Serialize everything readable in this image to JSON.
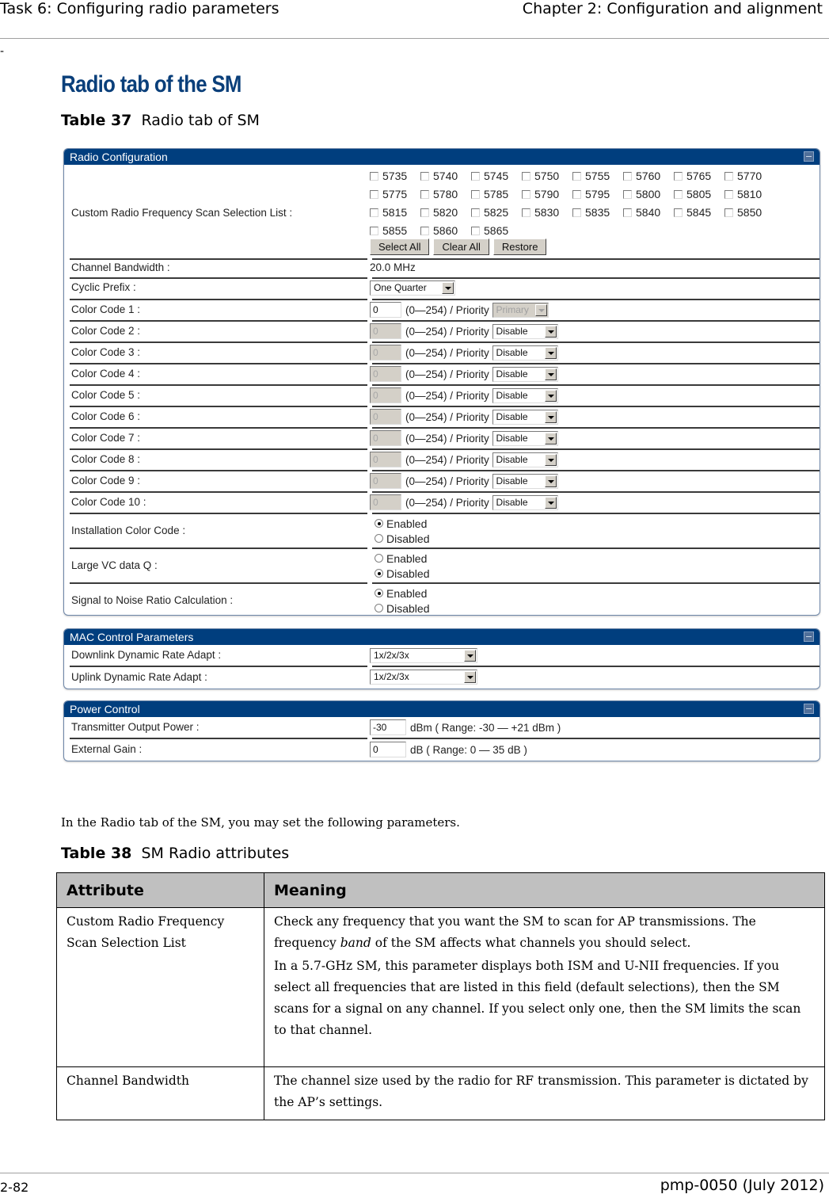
{
  "header": {
    "left": "Task 6: Configuring radio parameters",
    "right": "Chapter 2:  Configuration and alignment",
    "dash": "-"
  },
  "section_title": "Radio tab of the SM",
  "table37": {
    "label": "Table 37",
    "title": "Radio tab of SM"
  },
  "radio_config": {
    "title": "Radio Configuration",
    "scan_list": {
      "label": "Custom Radio Frequency Scan Selection List :",
      "frequencies": [
        "5735",
        "5740",
        "5745",
        "5750",
        "5755",
        "5760",
        "5765",
        "5770",
        "5775",
        "5780",
        "5785",
        "5790",
        "5795",
        "5800",
        "5805",
        "5810",
        "5815",
        "5820",
        "5825",
        "5830",
        "5835",
        "5840",
        "5845",
        "5850",
        "5855",
        "5860",
        "5865"
      ],
      "checked": [],
      "buttons": {
        "select_all": "Select All",
        "clear_all": "Clear All",
        "restore": "Restore"
      }
    },
    "channel_bandwidth": {
      "label": "Channel Bandwidth :",
      "value": "20.0 MHz"
    },
    "cyclic_prefix": {
      "label": "Cyclic Prefix :",
      "value": "One Quarter"
    },
    "color_codes": [
      {
        "label": "Color Code 1 :",
        "value": "0",
        "range": "(0—254) / Priority",
        "priority": "Primary",
        "disabled": false
      },
      {
        "label": "Color Code 2 :",
        "value": "0",
        "range": "(0—254) / Priority",
        "priority": "Disable",
        "disabled": true
      },
      {
        "label": "Color Code 3 :",
        "value": "0",
        "range": "(0—254) / Priority",
        "priority": "Disable",
        "disabled": true
      },
      {
        "label": "Color Code 4 :",
        "value": "0",
        "range": "(0—254) / Priority",
        "priority": "Disable",
        "disabled": true
      },
      {
        "label": "Color Code 5 :",
        "value": "0",
        "range": "(0—254) / Priority",
        "priority": "Disable",
        "disabled": true
      },
      {
        "label": "Color Code 6 :",
        "value": "0",
        "range": "(0—254) / Priority",
        "priority": "Disable",
        "disabled": true
      },
      {
        "label": "Color Code 7 :",
        "value": "0",
        "range": "(0—254) / Priority",
        "priority": "Disable",
        "disabled": true
      },
      {
        "label": "Color Code 8 :",
        "value": "0",
        "range": "(0—254) / Priority",
        "priority": "Disable",
        "disabled": true
      },
      {
        "label": "Color Code 9 :",
        "value": "0",
        "range": "(0—254) / Priority",
        "priority": "Disable",
        "disabled": true
      },
      {
        "label": "Color Code 10 :",
        "value": "0",
        "range": "(0—254) / Priority",
        "priority": "Disable",
        "disabled": true
      }
    ],
    "radios": [
      {
        "label": "Installation Color Code :",
        "options": [
          "Enabled",
          "Disabled"
        ],
        "selected": "Enabled"
      },
      {
        "label": "Large VC data Q :",
        "options": [
          "Enabled",
          "Disabled"
        ],
        "selected": "Disabled"
      },
      {
        "label": "Signal to Noise Ratio Calculation :",
        "options": [
          "Enabled",
          "Disabled"
        ],
        "selected": "Enabled"
      }
    ]
  },
  "mac_control": {
    "title": "MAC Control Parameters",
    "rows": [
      {
        "label": "Downlink Dynamic Rate Adapt :",
        "value": "1x/2x/3x"
      },
      {
        "label": "Uplink Dynamic Rate Adapt :",
        "value": "1x/2x/3x"
      }
    ]
  },
  "power_control": {
    "title": "Power Control",
    "rows": [
      {
        "label": "Transmitter Output Power :",
        "value": "-30",
        "range": "dBm ( Range: -30 — +21 dBm )"
      },
      {
        "label": "External Gain :",
        "value": "0",
        "range": "dB ( Range: 0 — 35 dB )"
      }
    ]
  },
  "intro_text": "In the Radio tab of the SM, you may set the following parameters.",
  "table38": {
    "label": "Table 38",
    "title": "SM Radio attributes",
    "headers": [
      "Attribute",
      "Meaning"
    ],
    "rows": [
      {
        "attribute": "Custom Radio Frequency Scan Selection List",
        "meaning_p1_before": "Check any frequency that you want the SM to scan for AP transmissions. The frequency ",
        "meaning_p1_em": "band",
        "meaning_p1_after": " of the SM affects what channels you should select.",
        "meaning_p2": "In a 5.7-GHz SM, this parameter displays both ISM and U-NII frequencies. If you select all frequencies that are listed in this field (default selections), then the SM scans for a signal on any channel. If you select only one, then the SM limits the scan to that channel."
      },
      {
        "attribute": "Channel Bandwidth",
        "meaning": "The channel size used by the radio for RF transmission.  This parameter is dictated by the AP’s settings."
      }
    ]
  },
  "footer": {
    "page": "2-82",
    "doc": "pmp-0050 (July 2012)"
  }
}
